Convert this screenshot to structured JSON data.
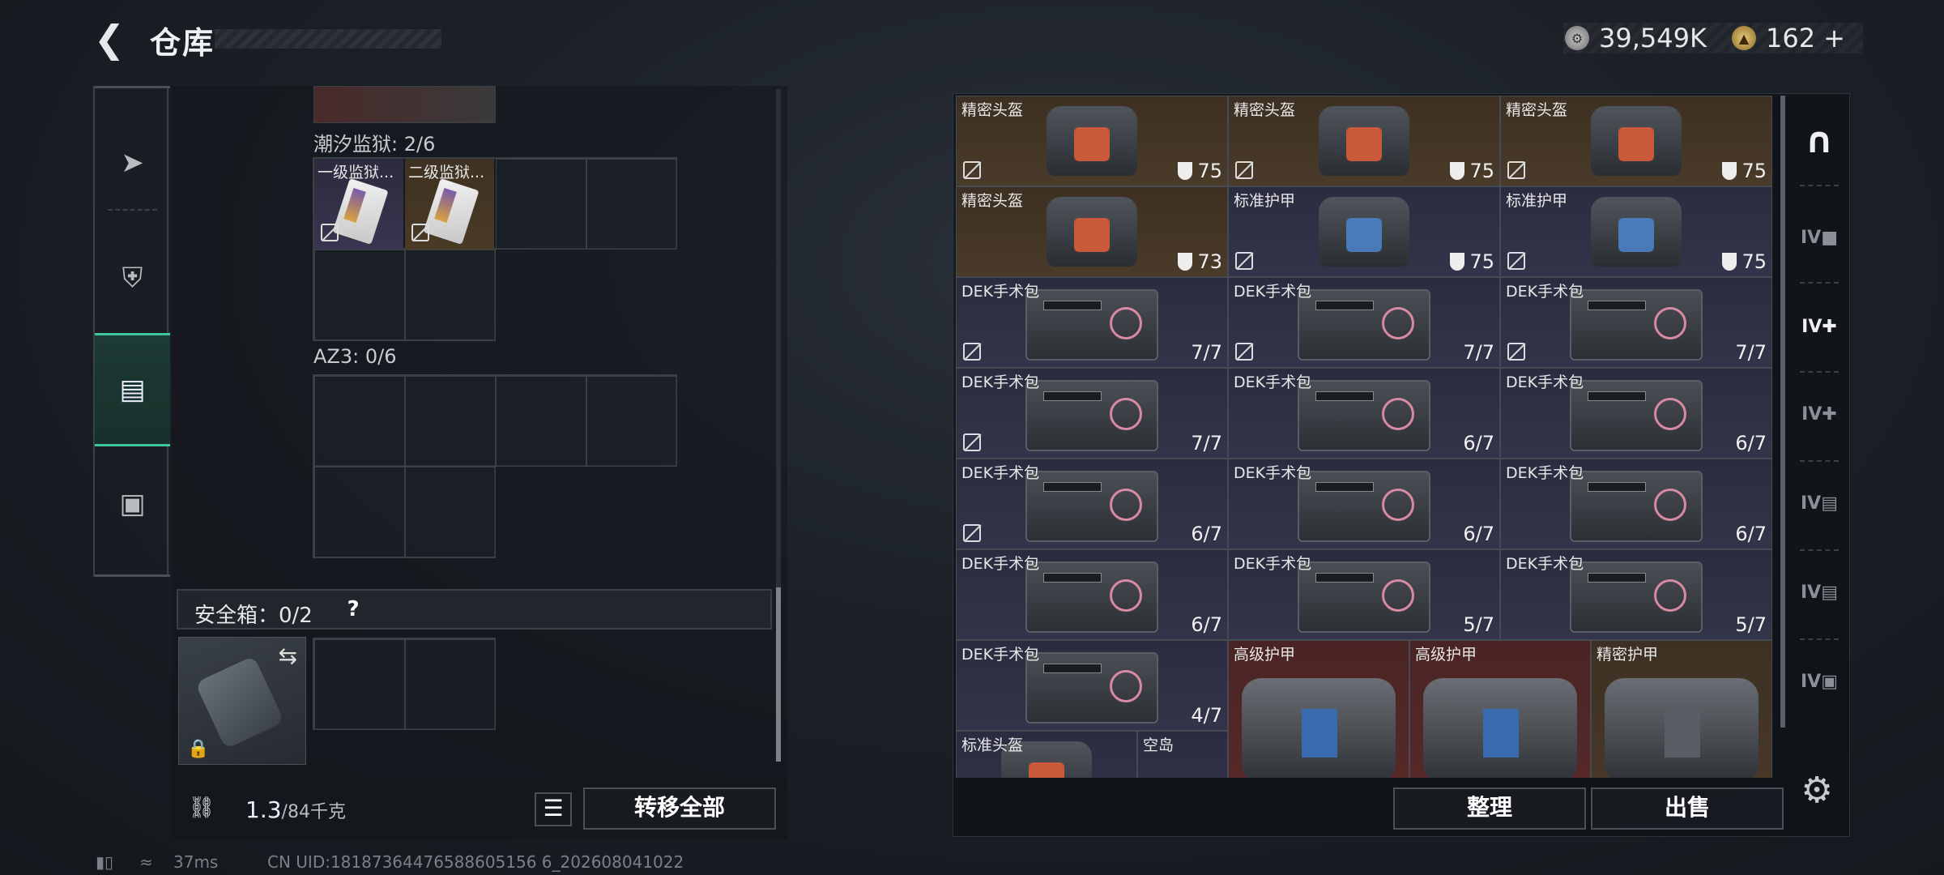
{
  "header": {
    "title": "仓库",
    "back_icon": "back-arrow-icon"
  },
  "currency": {
    "silver_value": "39,549K",
    "gold_value": "162",
    "gold_plus": "+"
  },
  "left_nav": [
    {
      "icon": "pistol-icon",
      "glyph": "⌁"
    },
    {
      "icon": "armor-vest-icon",
      "glyph": "♁"
    },
    {
      "icon": "backpack-icon",
      "glyph": "▤"
    },
    {
      "icon": "briefcase-icon",
      "glyph": "▣"
    }
  ],
  "containers": [
    {
      "label": "潮汐监狱: 2/6",
      "items": [
        {
          "name": "一级监狱..."
        },
        {
          "name": "二级监狱..."
        }
      ]
    },
    {
      "label": "AZ3: 0/6"
    }
  ],
  "safebox": {
    "label": "安全箱：0/2",
    "help": "?"
  },
  "footer_left": {
    "weight": "1.3",
    "weight_max": "/84千克",
    "transfer_all": "转移全部",
    "list_icon": "list-icon",
    "kg_icon": "weight-lock-icon"
  },
  "status": {
    "ping": "37ms",
    "uid": "CN UID:18187364476588605156 6_202608041022"
  },
  "stash_items": [
    {
      "name": "精密头盔",
      "value": "75",
      "kind": "helm",
      "color": "brown"
    },
    {
      "name": "精密头盔",
      "value": "75",
      "kind": "helm",
      "color": "brown"
    },
    {
      "name": "精密头盔",
      "value": "75",
      "kind": "helm",
      "color": "brown"
    },
    {
      "name": "精密头盔",
      "value": "73",
      "kind": "helm",
      "color": "brown"
    },
    {
      "name": "标准护甲",
      "value": "75",
      "kind": "helm-blue",
      "color": "navy"
    },
    {
      "name": "标准护甲",
      "value": "75",
      "kind": "helm-blue",
      "color": "navy"
    },
    {
      "name": "DEK手术包",
      "value": "7/7",
      "kind": "kit",
      "color": "navy"
    },
    {
      "name": "DEK手术包",
      "value": "7/7",
      "kind": "kit",
      "color": "navy"
    },
    {
      "name": "DEK手术包",
      "value": "7/7",
      "kind": "kit",
      "color": "navy"
    },
    {
      "name": "DEK手术包",
      "value": "7/7",
      "kind": "kit",
      "color": "navy"
    },
    {
      "name": "DEK手术包",
      "value": "6/7",
      "kind": "kit",
      "color": "navy"
    },
    {
      "name": "DEK手术包",
      "value": "6/7",
      "kind": "kit",
      "color": "navy"
    },
    {
      "name": "DEK手术包",
      "value": "6/7",
      "kind": "kit",
      "color": "navy"
    },
    {
      "name": "DEK手术包",
      "value": "6/7",
      "kind": "kit",
      "color": "navy"
    },
    {
      "name": "DEK手术包",
      "value": "6/7",
      "kind": "kit",
      "color": "navy"
    },
    {
      "name": "DEK手术包",
      "value": "6/7",
      "kind": "kit",
      "color": "navy"
    },
    {
      "name": "DEK手术包",
      "value": "5/7",
      "kind": "kit",
      "color": "navy"
    },
    {
      "name": "DEK手术包",
      "value": "5/7",
      "kind": "kit",
      "color": "navy"
    },
    {
      "name": "DEK手术包",
      "value": "4/7",
      "kind": "kit",
      "color": "navy"
    },
    {
      "name": "高级护甲",
      "value": "",
      "kind": "armor",
      "color": "red"
    },
    {
      "name": "高级护甲",
      "value": "",
      "kind": "armor",
      "color": "red"
    },
    {
      "name": "精密护甲",
      "value": "",
      "kind": "armor-grey",
      "color": "brown"
    },
    {
      "name": "标准头盔",
      "value": "",
      "kind": "helm",
      "color": "navy"
    },
    {
      "name": "空岛",
      "value": "",
      "kind": "none",
      "color": "navy"
    }
  ],
  "right_nav": [
    {
      "icon": "stash-arch-icon",
      "glyph": "∩",
      "active": true
    },
    {
      "icon": "iv-weapon-icon",
      "glyph": "IV",
      "active": false
    },
    {
      "icon": "iv-medical-add-icon",
      "glyph": "IV+",
      "active": true
    },
    {
      "icon": "iv-medical-icon",
      "glyph": "IV+",
      "active": false
    },
    {
      "icon": "iv-ammo-icon",
      "glyph": "IV",
      "active": false
    },
    {
      "icon": "iv-ammo-box-icon",
      "glyph": "IV",
      "active": false
    },
    {
      "icon": "iv-key-icon",
      "glyph": "IV",
      "active": false
    }
  ],
  "footer_right": {
    "sort": "整理",
    "sell": "出售"
  }
}
